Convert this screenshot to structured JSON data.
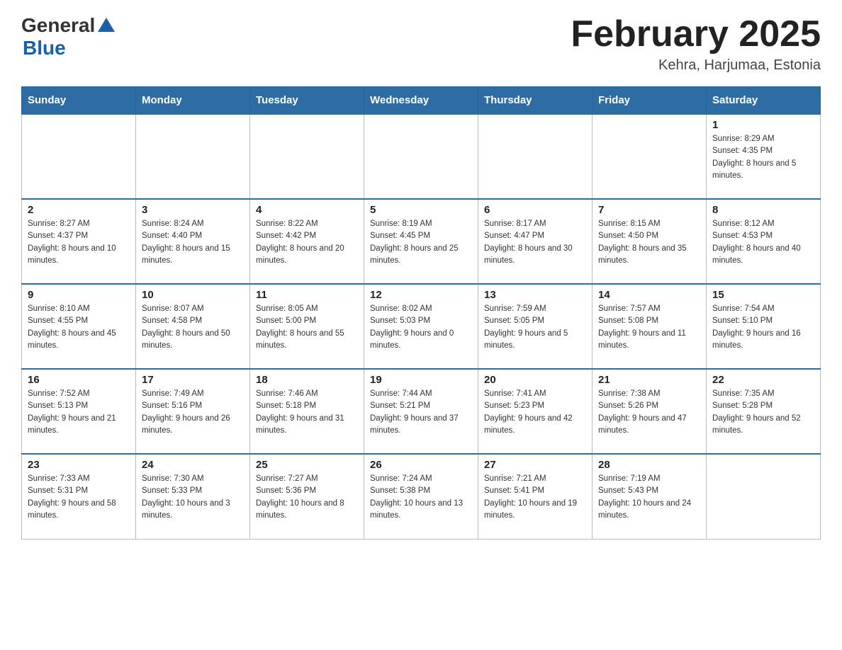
{
  "header": {
    "logo_general": "General",
    "logo_blue": "Blue",
    "month_title": "February 2025",
    "location": "Kehra, Harjumaa, Estonia"
  },
  "days_of_week": [
    "Sunday",
    "Monday",
    "Tuesday",
    "Wednesday",
    "Thursday",
    "Friday",
    "Saturday"
  ],
  "weeks": [
    [
      {
        "day": "",
        "info": ""
      },
      {
        "day": "",
        "info": ""
      },
      {
        "day": "",
        "info": ""
      },
      {
        "day": "",
        "info": ""
      },
      {
        "day": "",
        "info": ""
      },
      {
        "day": "",
        "info": ""
      },
      {
        "day": "1",
        "info": "Sunrise: 8:29 AM\nSunset: 4:35 PM\nDaylight: 8 hours and 5 minutes."
      }
    ],
    [
      {
        "day": "2",
        "info": "Sunrise: 8:27 AM\nSunset: 4:37 PM\nDaylight: 8 hours and 10 minutes."
      },
      {
        "day": "3",
        "info": "Sunrise: 8:24 AM\nSunset: 4:40 PM\nDaylight: 8 hours and 15 minutes."
      },
      {
        "day": "4",
        "info": "Sunrise: 8:22 AM\nSunset: 4:42 PM\nDaylight: 8 hours and 20 minutes."
      },
      {
        "day": "5",
        "info": "Sunrise: 8:19 AM\nSunset: 4:45 PM\nDaylight: 8 hours and 25 minutes."
      },
      {
        "day": "6",
        "info": "Sunrise: 8:17 AM\nSunset: 4:47 PM\nDaylight: 8 hours and 30 minutes."
      },
      {
        "day": "7",
        "info": "Sunrise: 8:15 AM\nSunset: 4:50 PM\nDaylight: 8 hours and 35 minutes."
      },
      {
        "day": "8",
        "info": "Sunrise: 8:12 AM\nSunset: 4:53 PM\nDaylight: 8 hours and 40 minutes."
      }
    ],
    [
      {
        "day": "9",
        "info": "Sunrise: 8:10 AM\nSunset: 4:55 PM\nDaylight: 8 hours and 45 minutes."
      },
      {
        "day": "10",
        "info": "Sunrise: 8:07 AM\nSunset: 4:58 PM\nDaylight: 8 hours and 50 minutes."
      },
      {
        "day": "11",
        "info": "Sunrise: 8:05 AM\nSunset: 5:00 PM\nDaylight: 8 hours and 55 minutes."
      },
      {
        "day": "12",
        "info": "Sunrise: 8:02 AM\nSunset: 5:03 PM\nDaylight: 9 hours and 0 minutes."
      },
      {
        "day": "13",
        "info": "Sunrise: 7:59 AM\nSunset: 5:05 PM\nDaylight: 9 hours and 5 minutes."
      },
      {
        "day": "14",
        "info": "Sunrise: 7:57 AM\nSunset: 5:08 PM\nDaylight: 9 hours and 11 minutes."
      },
      {
        "day": "15",
        "info": "Sunrise: 7:54 AM\nSunset: 5:10 PM\nDaylight: 9 hours and 16 minutes."
      }
    ],
    [
      {
        "day": "16",
        "info": "Sunrise: 7:52 AM\nSunset: 5:13 PM\nDaylight: 9 hours and 21 minutes."
      },
      {
        "day": "17",
        "info": "Sunrise: 7:49 AM\nSunset: 5:16 PM\nDaylight: 9 hours and 26 minutes."
      },
      {
        "day": "18",
        "info": "Sunrise: 7:46 AM\nSunset: 5:18 PM\nDaylight: 9 hours and 31 minutes."
      },
      {
        "day": "19",
        "info": "Sunrise: 7:44 AM\nSunset: 5:21 PM\nDaylight: 9 hours and 37 minutes."
      },
      {
        "day": "20",
        "info": "Sunrise: 7:41 AM\nSunset: 5:23 PM\nDaylight: 9 hours and 42 minutes."
      },
      {
        "day": "21",
        "info": "Sunrise: 7:38 AM\nSunset: 5:26 PM\nDaylight: 9 hours and 47 minutes."
      },
      {
        "day": "22",
        "info": "Sunrise: 7:35 AM\nSunset: 5:28 PM\nDaylight: 9 hours and 52 minutes."
      }
    ],
    [
      {
        "day": "23",
        "info": "Sunrise: 7:33 AM\nSunset: 5:31 PM\nDaylight: 9 hours and 58 minutes."
      },
      {
        "day": "24",
        "info": "Sunrise: 7:30 AM\nSunset: 5:33 PM\nDaylight: 10 hours and 3 minutes."
      },
      {
        "day": "25",
        "info": "Sunrise: 7:27 AM\nSunset: 5:36 PM\nDaylight: 10 hours and 8 minutes."
      },
      {
        "day": "26",
        "info": "Sunrise: 7:24 AM\nSunset: 5:38 PM\nDaylight: 10 hours and 13 minutes."
      },
      {
        "day": "27",
        "info": "Sunrise: 7:21 AM\nSunset: 5:41 PM\nDaylight: 10 hours and 19 minutes."
      },
      {
        "day": "28",
        "info": "Sunrise: 7:19 AM\nSunset: 5:43 PM\nDaylight: 10 hours and 24 minutes."
      },
      {
        "day": "",
        "info": ""
      }
    ]
  ]
}
